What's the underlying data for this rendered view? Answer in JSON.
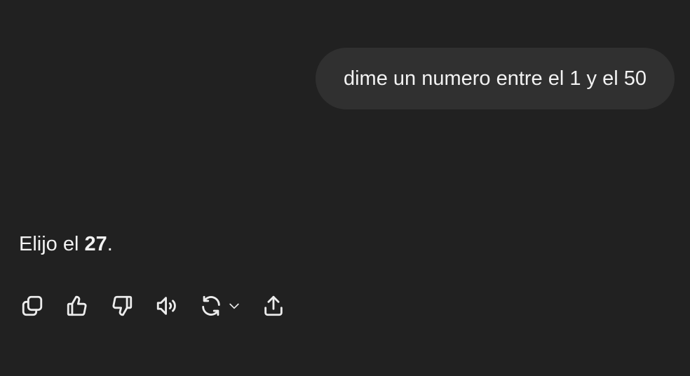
{
  "conversation": {
    "user_message": "dime un numero entre el 1 y el 50",
    "assistant_message": {
      "prefix": "Elijo el ",
      "bold": "27",
      "suffix": "."
    }
  },
  "actions": [
    {
      "icon": "copy-icon"
    },
    {
      "icon": "thumbs-up-icon"
    },
    {
      "icon": "thumbs-down-icon"
    },
    {
      "icon": "read-aloud-icon"
    },
    {
      "icon": "regenerate-icon"
    },
    {
      "icon": "share-icon"
    }
  ],
  "colors": {
    "background": "#212121",
    "user_bubble": "#303030",
    "text": "#ececec"
  }
}
